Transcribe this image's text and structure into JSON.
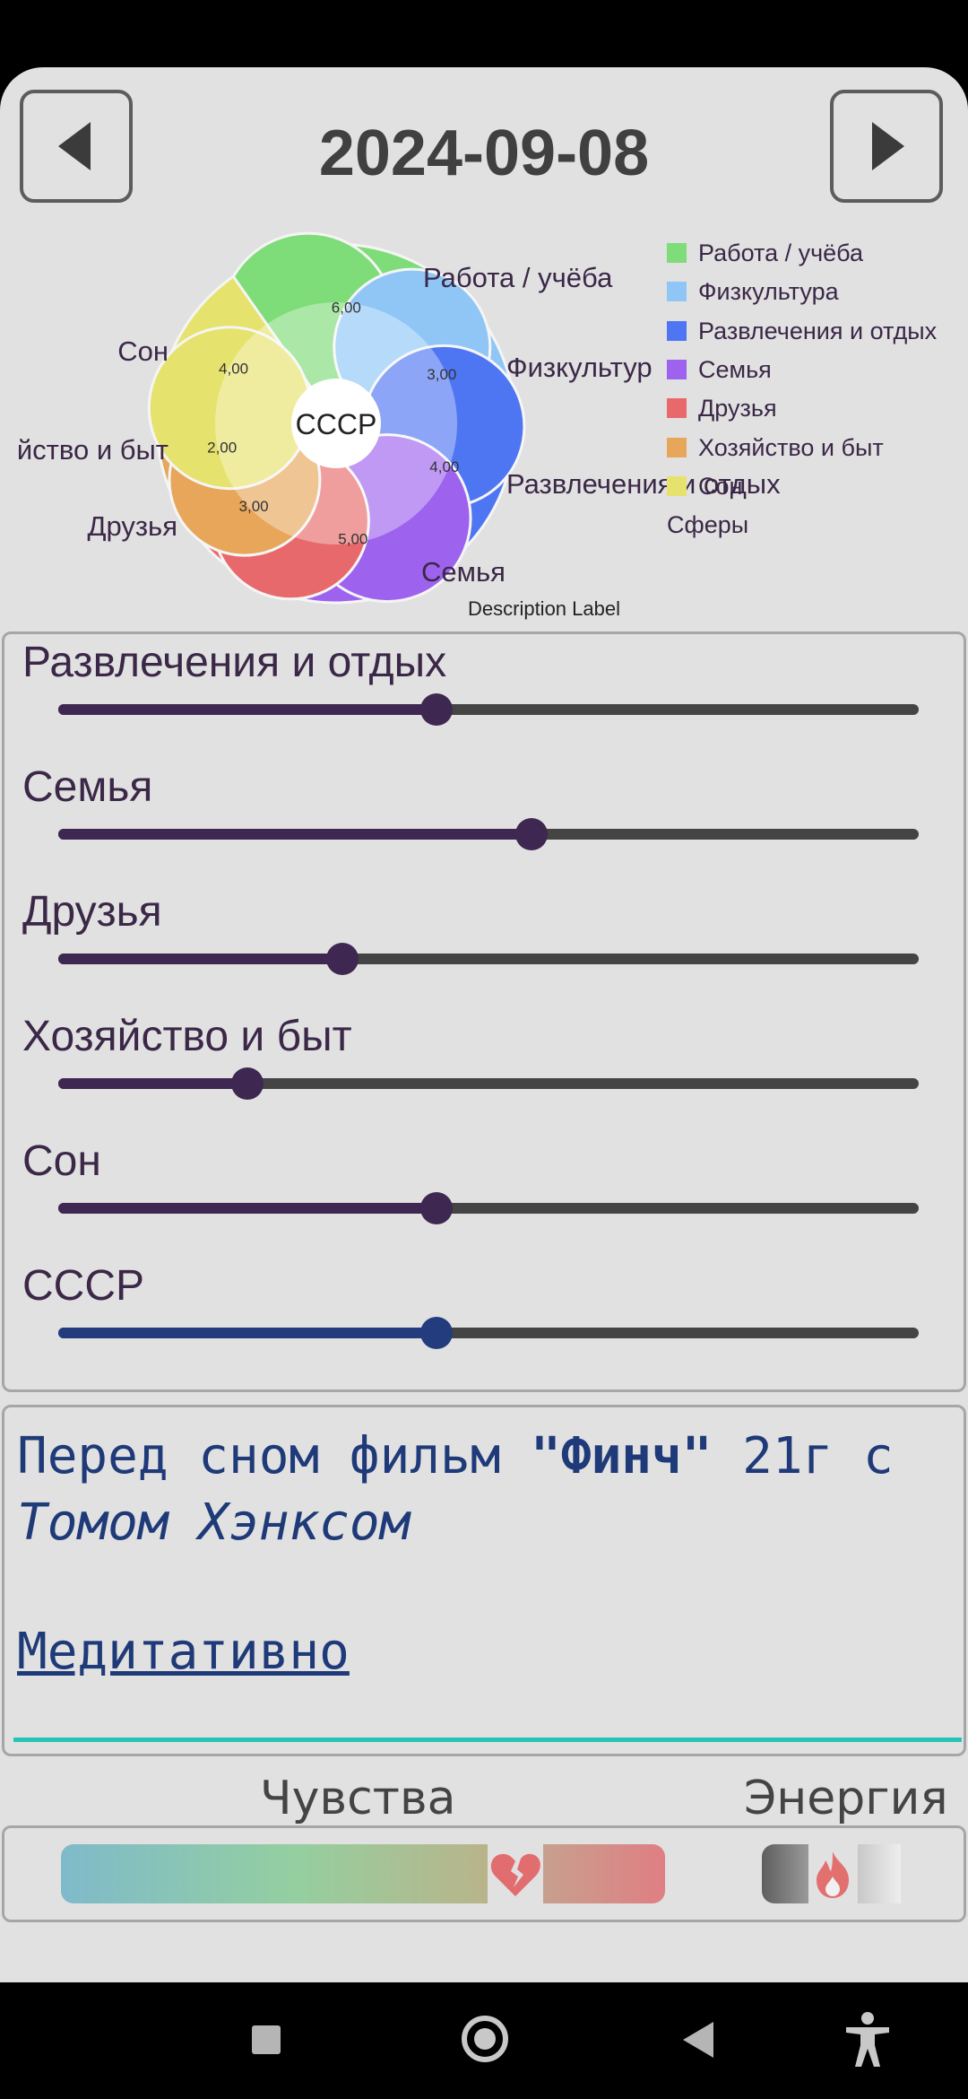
{
  "header": {
    "date": "2024-09-08",
    "prev_icon": "triangle-left-icon",
    "next_icon": "triangle-right-icon"
  },
  "chart_data": {
    "type": "pie",
    "center_label": "СССР",
    "description_label": "Description Label",
    "legend_title": "Сферы",
    "legend_placement": "right",
    "slices": [
      {
        "label": "Работа / учёба",
        "value": 6.0,
        "value_text": "6,00",
        "color": "#7edc79"
      },
      {
        "label": "Физкультура",
        "value": 3.0,
        "value_text": "3,00",
        "color": "#8fc6f6"
      },
      {
        "label": "Развлечения и отдых",
        "value": 4.0,
        "value_text": "4,00",
        "color": "#4f76f2"
      },
      {
        "label": "Семья",
        "value": 5.0,
        "value_text": "5,00",
        "color": "#9d63ee"
      },
      {
        "label": "Друзья",
        "value": 3.0,
        "value_text": "3,00",
        "color": "#e8696b"
      },
      {
        "label": "Хозяйство и быт",
        "value": 2.0,
        "value_text": "2,00",
        "color": "#e7a659"
      },
      {
        "label": "Сон",
        "value": 4.0,
        "value_text": "4,00",
        "color": "#e6e26e"
      }
    ],
    "outer_labels": {
      "work": "Работа / учёба",
      "fitness": "Физкультур",
      "fun": "Развлечения и отдых",
      "family": "Семья",
      "friends": "Друзья",
      "household": "йство и быт",
      "sleep": "Сон"
    }
  },
  "sliders": [
    {
      "label": "Развлечения и отдых",
      "value_percent": 44,
      "color": "#3e2750"
    },
    {
      "label": "Семья",
      "value_percent": 55,
      "color": "#3e2750"
    },
    {
      "label": "Друзья",
      "value_percent": 33,
      "color": "#3e2750"
    },
    {
      "label": "Хозяйство и быт",
      "value_percent": 22,
      "color": "#3e2750"
    },
    {
      "label": "Сон",
      "value_percent": 44,
      "color": "#3e2750"
    },
    {
      "label": "СССР",
      "value_percent": 44,
      "color": "#223c7e"
    }
  ],
  "notes": {
    "line1_a": "Перед сном фильм ",
    "line1_b": "\"Финч\"",
    "line1_c": " 21г с",
    "line2": "Томом Хэнксом",
    "line3": "Медитативно"
  },
  "bottom": {
    "feelings_label": "Чувства",
    "energy_label": "Энергия",
    "feelings_icon": "broken-heart-icon",
    "energy_icon": "flame-icon"
  },
  "system_nav": {
    "recents_icon": "square-icon",
    "home_icon": "circle-home-icon",
    "back_icon": "triangle-back-icon",
    "accessibility_icon": "accessibility-icon"
  }
}
